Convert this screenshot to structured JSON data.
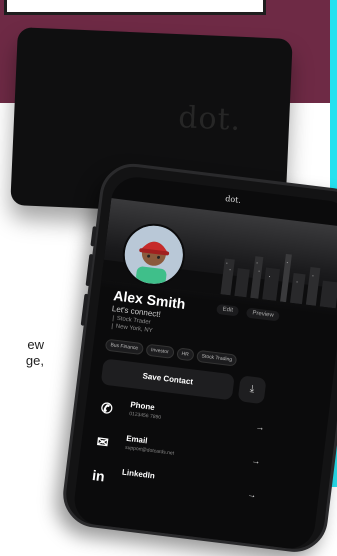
{
  "background": {
    "accent_color": "#6e2a45",
    "edge_color": "#27e1ef",
    "text_lines": [
      "ew",
      "ge,"
    ]
  },
  "card": {
    "logo": "dot."
  },
  "phone": {
    "status_title": "dot.",
    "profile": {
      "name": "Alex Smith",
      "edit_label": "Edit",
      "preview_label": "Preview",
      "tagline": "Let's connect!",
      "subtitle_1": "Stock Trader",
      "subtitle_2": "New York, NY"
    },
    "chips": [
      "Bus Finance",
      "Investor",
      "HR",
      "Stock Trading"
    ],
    "save_contact_label": "Save Contact",
    "download_icon": "download-icon",
    "contacts": [
      {
        "icon": "phone-icon",
        "glyph": "✆",
        "title": "Phone",
        "value": "0123456 7890"
      },
      {
        "icon": "email-icon",
        "glyph": "✉",
        "title": "Email",
        "value": "support@dotcards.net"
      },
      {
        "icon": "linkedin-icon",
        "glyph": "in",
        "title": "LinkedIn",
        "value": ""
      }
    ]
  }
}
